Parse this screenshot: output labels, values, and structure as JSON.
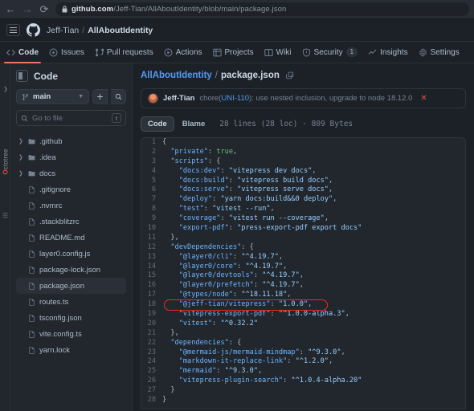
{
  "browser": {
    "back_icon": "arrow-left-icon",
    "forward_icon": "arrow-right-icon",
    "reload_icon": "reload-icon",
    "lock_icon": "lock-icon",
    "url_domain": "github.com",
    "url_path": "/Jeff-Tian/AllAboutIdentity/blob/main/package.json"
  },
  "header": {
    "menu_icon": "hamburger-menu-icon",
    "logo_icon": "github-logo-icon",
    "owner": "Jeff-Tian",
    "separator": "/",
    "repo": "AllAboutIdentity"
  },
  "repo_nav": {
    "items": [
      {
        "label": "Code",
        "icon": "code-icon",
        "active": true
      },
      {
        "label": "Issues",
        "icon": "issue-opened-icon",
        "active": false
      },
      {
        "label": "Pull requests",
        "icon": "git-pull-request-icon",
        "active": false
      },
      {
        "label": "Actions",
        "icon": "play-icon",
        "active": false
      },
      {
        "label": "Projects",
        "icon": "table-icon",
        "active": false
      },
      {
        "label": "Wiki",
        "icon": "book-icon",
        "active": false
      },
      {
        "label": "Security",
        "icon": "shield-icon",
        "active": false,
        "badge": "1"
      },
      {
        "label": "Insights",
        "icon": "graph-icon",
        "active": false
      },
      {
        "label": "Settings",
        "icon": "gear-icon",
        "active": false
      }
    ]
  },
  "octotree": {
    "label": "Octotree",
    "logo_letter": "O",
    "rest": "ctotree",
    "chevron_icon": "chevron-right-icon",
    "grip_icon": "grip-icon"
  },
  "sidebar": {
    "panel_icon": "sidebar-panel-icon",
    "title": "Code",
    "branch": {
      "icon": "git-branch-icon",
      "name": "main",
      "caret_icon": "chevron-down-icon"
    },
    "add_icon": "plus-icon",
    "search_icon": "search-icon",
    "file_search": {
      "icon": "search-icon",
      "placeholder": "Go to file",
      "shortcut": "t"
    },
    "tree": [
      {
        "name": ".github",
        "type": "folder",
        "selected": false
      },
      {
        "name": ".idea",
        "type": "folder",
        "selected": false
      },
      {
        "name": "docs",
        "type": "folder",
        "selected": false
      },
      {
        "name": ".gitignore",
        "type": "file",
        "selected": false
      },
      {
        "name": ".nvmrc",
        "type": "file",
        "selected": false
      },
      {
        "name": ".stackblitzrc",
        "type": "file",
        "selected": false
      },
      {
        "name": "README.md",
        "type": "file",
        "selected": false
      },
      {
        "name": "layer0.config.js",
        "type": "file",
        "selected": false
      },
      {
        "name": "package-lock.json",
        "type": "file",
        "selected": false
      },
      {
        "name": "package.json",
        "type": "file",
        "selected": true
      },
      {
        "name": "routes.ts",
        "type": "file",
        "selected": false
      },
      {
        "name": "tsconfig.json",
        "type": "file",
        "selected": false
      },
      {
        "name": "vite.config.ts",
        "type": "file",
        "selected": false
      },
      {
        "name": "yarn.lock",
        "type": "file",
        "selected": false
      }
    ]
  },
  "main": {
    "breadcrumb": {
      "repo": "AllAboutIdentity",
      "separator": "/",
      "file": "package.json",
      "copy_icon": "copy-path-icon"
    },
    "commit": {
      "avatar": "user-avatar",
      "author": "Jeff-Tian",
      "message_prefix": "chore(",
      "message_link": "UNI-110",
      "message_suffix": "): use nested inclusion, upgrade to node 18.12.0",
      "dismiss_icon": "close-icon"
    },
    "code_tabs": [
      {
        "label": "Code",
        "active": true
      },
      {
        "label": "Blame",
        "active": false
      }
    ],
    "file_meta": "28 lines (28 loc) · 809 Bytes",
    "highlight": {
      "line": 18,
      "color": "#f4261d"
    },
    "code_lines": [
      {
        "n": 1,
        "tokens": [
          {
            "t": "p",
            "v": "{"
          }
        ]
      },
      {
        "n": 2,
        "tokens": [
          {
            "t": "p",
            "v": "  "
          },
          {
            "t": "k",
            "v": "\"private\""
          },
          {
            "t": "p",
            "v": ": "
          },
          {
            "t": "b",
            "v": "true"
          },
          {
            "t": "p",
            "v": ","
          }
        ]
      },
      {
        "n": 3,
        "tokens": [
          {
            "t": "p",
            "v": "  "
          },
          {
            "t": "k",
            "v": "\"scripts\""
          },
          {
            "t": "p",
            "v": ": {"
          }
        ]
      },
      {
        "n": 4,
        "tokens": [
          {
            "t": "p",
            "v": "    "
          },
          {
            "t": "k",
            "v": "\"docs:dev\""
          },
          {
            "t": "p",
            "v": ": "
          },
          {
            "t": "s",
            "v": "\"vitepress dev docs\""
          },
          {
            "t": "p",
            "v": ","
          }
        ]
      },
      {
        "n": 5,
        "tokens": [
          {
            "t": "p",
            "v": "    "
          },
          {
            "t": "k",
            "v": "\"docs:build\""
          },
          {
            "t": "p",
            "v": ": "
          },
          {
            "t": "s",
            "v": "\"vitepress build docs\""
          },
          {
            "t": "p",
            "v": ","
          }
        ]
      },
      {
        "n": 6,
        "tokens": [
          {
            "t": "p",
            "v": "    "
          },
          {
            "t": "k",
            "v": "\"docs:serve\""
          },
          {
            "t": "p",
            "v": ": "
          },
          {
            "t": "s",
            "v": "\"vitepress serve docs\""
          },
          {
            "t": "p",
            "v": ","
          }
        ]
      },
      {
        "n": 7,
        "tokens": [
          {
            "t": "p",
            "v": "    "
          },
          {
            "t": "k",
            "v": "\"deploy\""
          },
          {
            "t": "p",
            "v": ": "
          },
          {
            "t": "s",
            "v": "\"yarn docs:build&&0 deploy\""
          },
          {
            "t": "p",
            "v": ","
          }
        ]
      },
      {
        "n": 8,
        "tokens": [
          {
            "t": "p",
            "v": "    "
          },
          {
            "t": "k",
            "v": "\"test\""
          },
          {
            "t": "p",
            "v": ": "
          },
          {
            "t": "s",
            "v": "\"vitest --run\""
          },
          {
            "t": "p",
            "v": ","
          }
        ]
      },
      {
        "n": 9,
        "tokens": [
          {
            "t": "p",
            "v": "    "
          },
          {
            "t": "k",
            "v": "\"coverage\""
          },
          {
            "t": "p",
            "v": ": "
          },
          {
            "t": "s",
            "v": "\"vitest run --coverage\""
          },
          {
            "t": "p",
            "v": ","
          }
        ]
      },
      {
        "n": 10,
        "tokens": [
          {
            "t": "p",
            "v": "    "
          },
          {
            "t": "k",
            "v": "\"export-pdf\""
          },
          {
            "t": "p",
            "v": ": "
          },
          {
            "t": "s",
            "v": "\"press-export-pdf export docs\""
          }
        ]
      },
      {
        "n": 11,
        "tokens": [
          {
            "t": "p",
            "v": "  },"
          }
        ]
      },
      {
        "n": 12,
        "tokens": [
          {
            "t": "p",
            "v": "  "
          },
          {
            "t": "k",
            "v": "\"devDependencies\""
          },
          {
            "t": "p",
            "v": ": {"
          }
        ]
      },
      {
        "n": 13,
        "tokens": [
          {
            "t": "p",
            "v": "    "
          },
          {
            "t": "k",
            "v": "\"@layer0/cli\""
          },
          {
            "t": "p",
            "v": ": "
          },
          {
            "t": "s",
            "v": "\"^4.19.7\""
          },
          {
            "t": "p",
            "v": ","
          }
        ]
      },
      {
        "n": 14,
        "tokens": [
          {
            "t": "p",
            "v": "    "
          },
          {
            "t": "k",
            "v": "\"@layer0/core\""
          },
          {
            "t": "p",
            "v": ": "
          },
          {
            "t": "s",
            "v": "\"^4.19.7\""
          },
          {
            "t": "p",
            "v": ","
          }
        ]
      },
      {
        "n": 15,
        "tokens": [
          {
            "t": "p",
            "v": "    "
          },
          {
            "t": "k",
            "v": "\"@layer0/devtools\""
          },
          {
            "t": "p",
            "v": ": "
          },
          {
            "t": "s",
            "v": "\"^4.19.7\""
          },
          {
            "t": "p",
            "v": ","
          }
        ]
      },
      {
        "n": 16,
        "tokens": [
          {
            "t": "p",
            "v": "    "
          },
          {
            "t": "k",
            "v": "\"@layer0/prefetch\""
          },
          {
            "t": "p",
            "v": ": "
          },
          {
            "t": "s",
            "v": "\"^4.19.7\""
          },
          {
            "t": "p",
            "v": ","
          }
        ]
      },
      {
        "n": 17,
        "tokens": [
          {
            "t": "p",
            "v": "    "
          },
          {
            "t": "k",
            "v": "\"@types/node\""
          },
          {
            "t": "p",
            "v": ": "
          },
          {
            "t": "s",
            "v": "\"^18.11.18\""
          },
          {
            "t": "p",
            "v": ","
          }
        ]
      },
      {
        "n": 18,
        "tokens": [
          {
            "t": "p",
            "v": "    "
          },
          {
            "t": "k",
            "v": "\"@jeff-tian/vitepress\""
          },
          {
            "t": "p",
            "v": ": "
          },
          {
            "t": "s",
            "v": "\"1.0.0\""
          },
          {
            "t": "p",
            "v": ","
          }
        ]
      },
      {
        "n": 19,
        "tokens": [
          {
            "t": "p",
            "v": "    "
          },
          {
            "t": "k",
            "v": "\"vitepress-export-pdf\""
          },
          {
            "t": "p",
            "v": ": "
          },
          {
            "t": "s",
            "v": "\"^1.0.0-alpha.3\""
          },
          {
            "t": "p",
            "v": ","
          }
        ]
      },
      {
        "n": 20,
        "tokens": [
          {
            "t": "p",
            "v": "    "
          },
          {
            "t": "k",
            "v": "\"vitest\""
          },
          {
            "t": "p",
            "v": ": "
          },
          {
            "t": "s",
            "v": "\"^0.32.2\""
          }
        ]
      },
      {
        "n": 21,
        "tokens": [
          {
            "t": "p",
            "v": "  },"
          }
        ]
      },
      {
        "n": 22,
        "tokens": [
          {
            "t": "p",
            "v": "  "
          },
          {
            "t": "k",
            "v": "\"dependencies\""
          },
          {
            "t": "p",
            "v": ": {"
          }
        ]
      },
      {
        "n": 23,
        "tokens": [
          {
            "t": "p",
            "v": "    "
          },
          {
            "t": "k",
            "v": "\"@mermaid-js/mermaid-mindmap\""
          },
          {
            "t": "p",
            "v": ": "
          },
          {
            "t": "s",
            "v": "\"^9.3.0\""
          },
          {
            "t": "p",
            "v": ","
          }
        ]
      },
      {
        "n": 24,
        "tokens": [
          {
            "t": "p",
            "v": "    "
          },
          {
            "t": "k",
            "v": "\"markdown-it-replace-link\""
          },
          {
            "t": "p",
            "v": ": "
          },
          {
            "t": "s",
            "v": "\"^1.2.0\""
          },
          {
            "t": "p",
            "v": ","
          }
        ]
      },
      {
        "n": 25,
        "tokens": [
          {
            "t": "p",
            "v": "    "
          },
          {
            "t": "k",
            "v": "\"mermaid\""
          },
          {
            "t": "p",
            "v": ": "
          },
          {
            "t": "s",
            "v": "\"^9.3.0\""
          },
          {
            "t": "p",
            "v": ","
          }
        ]
      },
      {
        "n": 26,
        "tokens": [
          {
            "t": "p",
            "v": "    "
          },
          {
            "t": "k",
            "v": "\"vitepress-plugin-search\""
          },
          {
            "t": "p",
            "v": ": "
          },
          {
            "t": "s",
            "v": "\"^1.0.4-alpha.20\""
          }
        ]
      },
      {
        "n": 27,
        "tokens": [
          {
            "t": "p",
            "v": "  }"
          }
        ]
      },
      {
        "n": 28,
        "tokens": [
          {
            "t": "p",
            "v": "}"
          }
        ]
      }
    ]
  },
  "colors": {
    "accent": "#539bf5",
    "active_tab_underline": "#ec775c",
    "highlight_red": "#f4261d",
    "key": "#6cb6ff",
    "string": "#96d0ff",
    "boolean": "#6bc46d"
  }
}
